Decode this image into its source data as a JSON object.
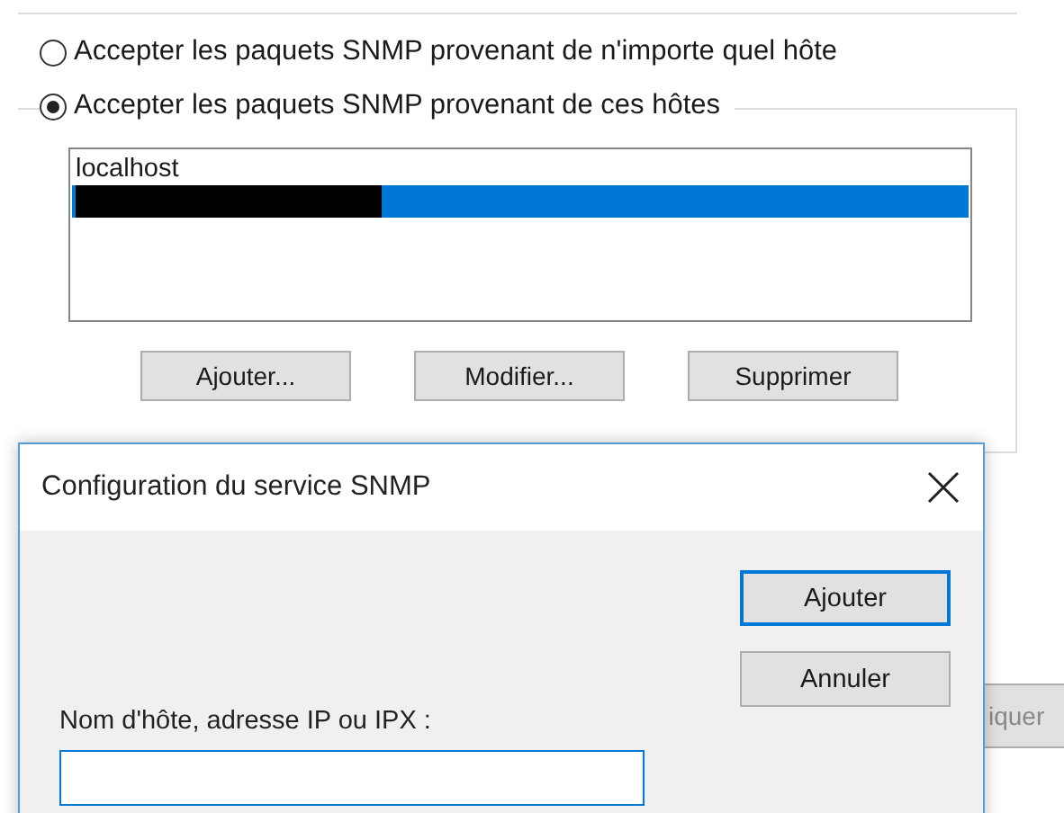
{
  "options": [
    {
      "label": "Accepter les paquets SNMP provenant de n'importe quel hôte",
      "selected": false
    },
    {
      "label": "Accepter les paquets SNMP provenant de ces hôtes",
      "selected": true
    }
  ],
  "hosts": [
    {
      "text": "localhost",
      "selected": false
    },
    {
      "redacted": true,
      "selected": true
    }
  ],
  "host_buttons": [
    "Ajouter...",
    "Modifier...",
    "Supprimer"
  ],
  "background_button": "iquer",
  "dialog": {
    "title": "Configuration du service SNMP",
    "buttons": [
      {
        "label": "Ajouter",
        "default": true
      },
      {
        "label": "Annuler",
        "default": false
      }
    ],
    "field_label": "Nom d'hôte, adresse IP ou IPX :",
    "field": {
      "focused": true
    }
  }
}
